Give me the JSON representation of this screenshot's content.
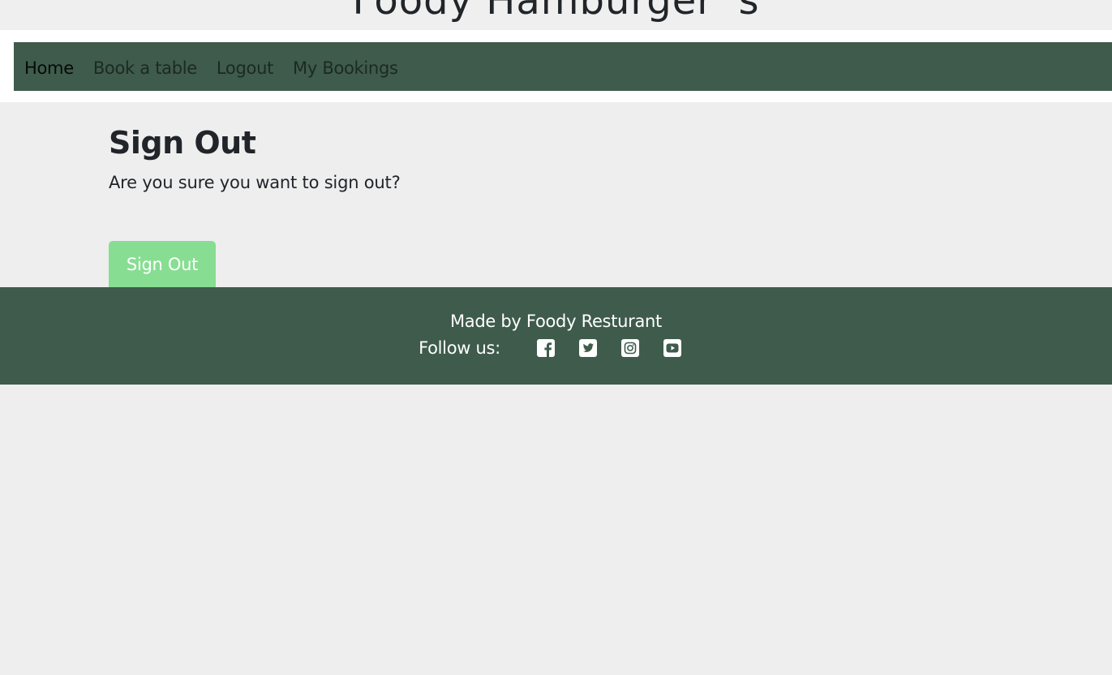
{
  "header": {
    "site_title": "Foody  Hamburger 's"
  },
  "nav": {
    "items": [
      {
        "label": "Home",
        "active": true
      },
      {
        "label": "Book a table",
        "active": false
      },
      {
        "label": "Logout",
        "active": false
      },
      {
        "label": "My Bookings",
        "active": false
      }
    ]
  },
  "main": {
    "heading": "Sign Out",
    "confirm_text": "Are you sure you want to sign out?",
    "signout_button": "Sign Out"
  },
  "footer": {
    "made_by": "Made by Foody Resturant",
    "follow_label": "Follow us:",
    "social_icons": [
      "facebook-icon",
      "twitter-icon",
      "instagram-icon",
      "youtube-icon"
    ]
  },
  "colors": {
    "navbar_bg": "#3e5b4c",
    "button_bg": "#87de92",
    "page_bg": "#eeeeee"
  }
}
